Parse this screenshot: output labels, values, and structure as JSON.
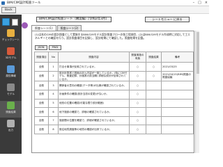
{
  "window": {
    "title": "BIM/CIM設計照査ツール",
    "controls": [
      "–",
      "□",
      "×"
    ]
  },
  "menubar": {
    "back_label": "Back"
  },
  "sidebar": {
    "items": [
      {
        "label": "チェックシート",
        "icon": "checklist-icon",
        "color": "#e8b040"
      },
      {
        "label": "3Dモデル",
        "icon": "model-icon",
        "color": "#d85a3a"
      },
      {
        "label": "属性情報",
        "icon": "attribute-icon",
        "color": "#5a9ad8"
      },
      {
        "label": "モデル",
        "icon": "model2-icon",
        "color": "#8a8a8a"
      },
      {
        "label": "照査結果",
        "icon": "results-icon",
        "color": "#6ab04c"
      },
      {
        "label": "出力",
        "icon": "output-icon",
        "color": "#b0b0b0"
      }
    ]
  },
  "header": {
    "title": "BIM/CIM設計照査シート（構造編）[令和2年3月]",
    "toggle_button": "シートモニュー に戻る"
  },
  "tabs": [
    {
      "label": "照査シート(1)"
    },
    {
      "label": "照査シート(2)"
    }
  ],
  "description": "(1)は本のCIMの設計照査として実施するBIM/CIMモデル設計照査フローの各工程項目、(2)はBIM/CIMモデル作成時に対応して工エネルギーとの確認を行う。設計照査項目を記録し、設計結果にて確認した。照査結果を記載。",
  "buttons": {
    "json": "JSON",
    "pwd": "PWD"
  },
  "table": {
    "headers": [
      "照査項目",
      "No",
      "照査内容",
      "照査実施の有無",
      "照査結果",
      "備考"
    ],
    "rows": [
      [
        "全般",
        "1",
        "打合せ事項が反映されているか。",
        "○",
        "○",
        "2021/03/25"
      ],
      [
        "全般",
        "2",
        "設計計算書と図面の記入内容が一致しているか。(特にCIMモデル、照査記録、計画書の該当欄) 詳細な設計が反映されているか。",
        "○",
        "○",
        "2021/04/15(BIM)照査の照査協議"
      ],
      [
        "全般",
        "3",
        "関係者の意向の確認(データ等)が出典が確認されているか。",
        "○",
        "",
        ""
      ],
      [
        "全般",
        "4",
        "計画条件の確認(設計当初の変更)がないか。",
        "○",
        "",
        ""
      ],
      [
        "全般",
        "5",
        "地形の位置の確認(可能な限り設計範囲)",
        "○",
        "",
        ""
      ],
      [
        "全般",
        "6",
        "地下施設の確認で、詳細の確認されているか。",
        "○",
        "",
        ""
      ],
      [
        "全般",
        "7",
        "施設間の位置を確認で、詳細が確認されているか。",
        "○",
        "",
        ""
      ],
      [
        "全般",
        "8",
        "既往地質調査等の地質の確認が出来ているか。",
        "○",
        "",
        ""
      ]
    ]
  }
}
